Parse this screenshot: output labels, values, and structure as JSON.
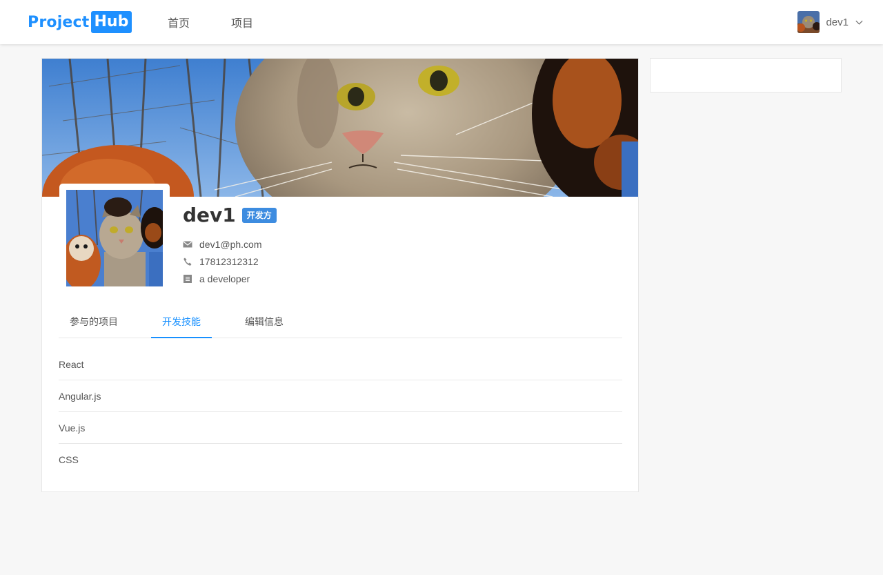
{
  "header": {
    "logo_part1": "Project",
    "logo_part2": "Hub",
    "nav": [
      "首页",
      "项目"
    ],
    "user_name": "dev1"
  },
  "profile": {
    "name": "dev1",
    "role_badge": "开发方",
    "email": "dev1@ph.com",
    "phone": "17812312312",
    "bio": "a developer"
  },
  "tabs": {
    "items": [
      "参与的项目",
      "开发技能",
      "编辑信息"
    ],
    "active": "开发技能"
  },
  "skills": [
    "React",
    "Angular.js",
    "Vue.js",
    "CSS"
  ],
  "colors": {
    "accent": "#1890ff",
    "badge": "#3d8ce0",
    "logo": "#1e90ff"
  }
}
